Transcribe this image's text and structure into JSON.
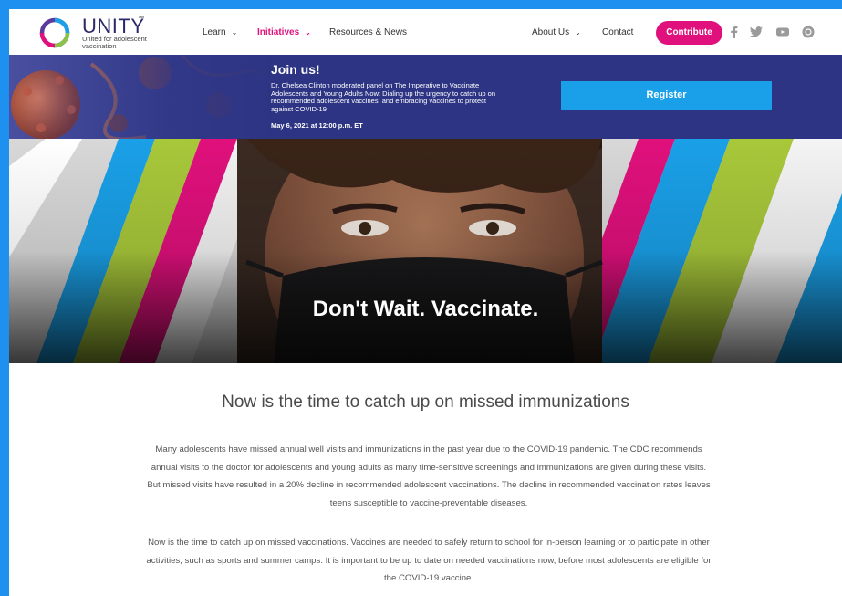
{
  "brand": {
    "name": "UNITY",
    "tm": "™",
    "tagline": "United for adolescent vaccination",
    "ring_colors": [
      "#1aa0e8",
      "#8bc34a",
      "#e0107c",
      "#5b3aa0"
    ]
  },
  "nav": {
    "items": [
      {
        "label": "Learn",
        "chevron": "⌄"
      },
      {
        "label": "Initiatives",
        "chevron": "⌄",
        "active": true
      },
      {
        "label": "Resources & News"
      },
      {
        "label": "About Us",
        "chevron": "⌄"
      },
      {
        "label": "Contact"
      }
    ],
    "contribute_label": "Contribute",
    "social_icons": [
      "facebook-icon",
      "twitter-icon",
      "youtube-icon",
      "instagram-icon"
    ]
  },
  "banner": {
    "title": "Join us!",
    "description": "Dr. Chelsea Clinton moderated panel on The Imperative to Vaccinate Adolescents and Young Adults Now: Dialing up the urgency to catch up on recommended adolescent vaccines, and embracing vaccines to protect against COVID-19",
    "date": "May 6, 2021 at 12:00 p.m. ET",
    "register_label": "Register"
  },
  "hero": {
    "title": "Don't Wait. Vaccinate."
  },
  "main": {
    "heading": "Now is the time to catch up on missed immunizations",
    "paragraphs": [
      "Many adolescents have missed annual well visits and immunizations in the past year due to the COVID-19 pandemic. The CDC recommends annual visits to the doctor for adolescents and young adults as many time-sensitive screenings and immunizations are given during these visits. But missed visits have resulted in a 20% decline in recommended adolescent vaccinations. The decline in recommended vaccination rates leaves teens susceptible to vaccine-preventable diseases.",
      "Now is the time to catch up on missed vaccinations. Vaccines are needed to safely return to school for in-person learning or to participate in other activities, such as sports and summer camps. It is important to be up to date on needed vaccinations now, before most adolescents are eligible for the COVID-19 vaccine."
    ]
  },
  "colors": {
    "accent_pink": "#e0107c",
    "banner_bg": "#2d3483",
    "register_blue": "#1aa0e8",
    "page_border": "#1e90f0"
  }
}
